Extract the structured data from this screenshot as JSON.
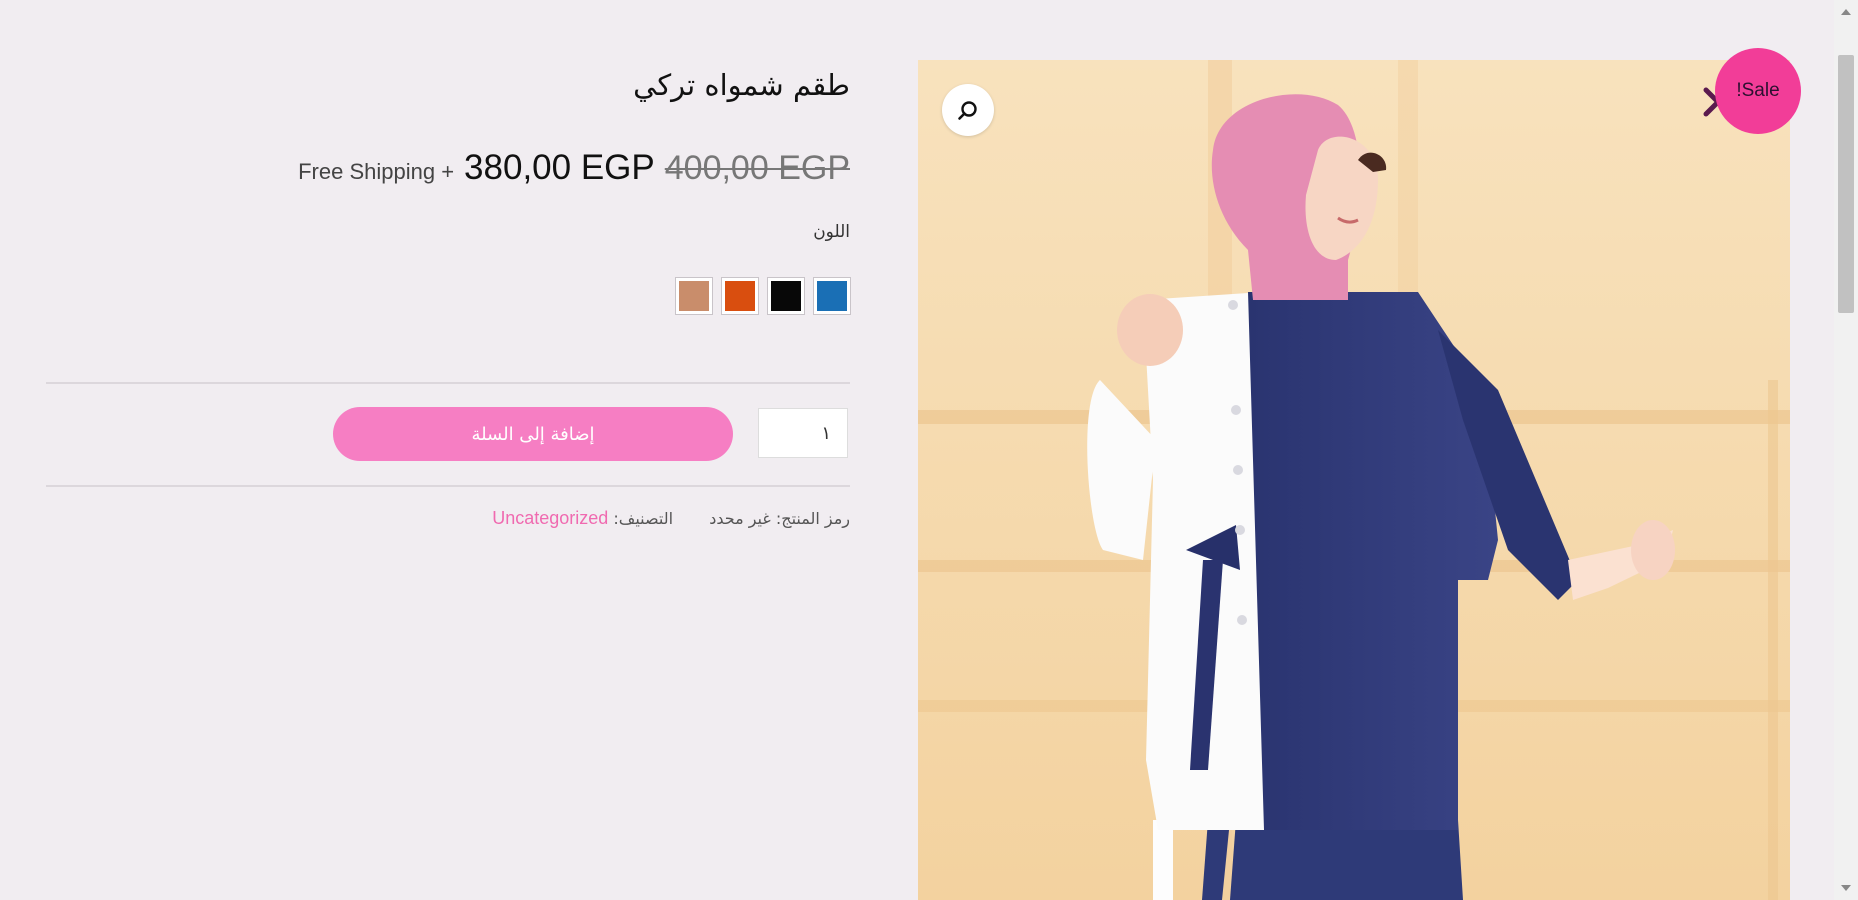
{
  "product": {
    "title": "طقم شمواه تركي",
    "price_old": "400,00 EGP",
    "price_new": "380,00 EGP",
    "shipping": "Free Shipping +",
    "color_label": "اللون",
    "swatches": [
      {
        "name": "blue",
        "hex": "#1a6fb5"
      },
      {
        "name": "black",
        "hex": "#080808"
      },
      {
        "name": "orange",
        "hex": "#d94e0f"
      },
      {
        "name": "tan",
        "hex": "#c98d6b"
      }
    ],
    "quantity": "١",
    "add_to_cart_label": "إضافة إلى السلة",
    "sku_label": "رمز المنتج:",
    "sku_value": "غير محدد",
    "category_label": "التصنيف:",
    "category_value": "Uncategorized",
    "sale_badge": "!Sale"
  },
  "colors": {
    "background": "#f1edf1",
    "accent_pink": "#f67ec3",
    "badge_pink": "#f23d98",
    "category_link": "#f06ab0"
  },
  "icons": {
    "zoom": "magnifier-icon",
    "close": "close-icon"
  }
}
